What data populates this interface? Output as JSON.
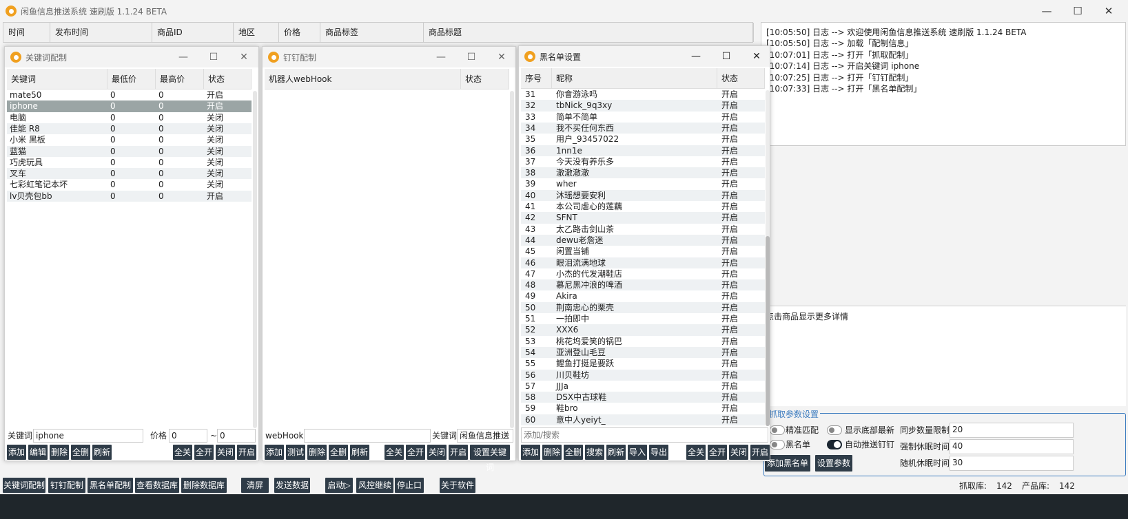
{
  "app": {
    "title": "闲鱼信息推送系统 速刷版 1.1.24 BETA"
  },
  "main_table": {
    "columns": [
      "时间",
      "发布时间",
      "商品ID",
      "地区",
      "价格",
      "商品标签",
      "商品标题"
    ]
  },
  "log": {
    "lines": [
      "[10:05:50] 日志 --> 欢迎使用闲鱼信息推送系统 速刷版 1.1.24 BETA",
      "[10:05:50] 日志 --> 加载「配制信息」",
      "[10:07:01] 日志 --> 打开「抓取配制」",
      "[10:07:14] 日志 --> 开启关键词 iphone",
      "[10:07:25] 日志 --> 打开「钉钉配制」",
      "[10:07:33] 日志 --> 打开「黑名单配制」"
    ]
  },
  "detail": {
    "hint": "点击商品显示更多详情"
  },
  "settings": {
    "group_title": "抓取参数设置",
    "exact_match": "精准匹配",
    "blacklist": "黑名单",
    "show_bottom_latest": "显示底部最新",
    "auto_push": "自动推送钉钉",
    "sync_limit_label": "同步数量限制",
    "sync_limit_value": "20",
    "force_sleep_label": "强制休眠时间",
    "force_sleep_value": "40",
    "random_sleep_label": "随机休眠时间",
    "random_sleep_value": "30",
    "add_blacklist_btn": "添加黑名单",
    "set_params_btn": "设置参数"
  },
  "keyword_panel": {
    "title": "关键词配制",
    "columns": [
      "关键词",
      "最低价",
      "最高价",
      "状态"
    ],
    "rows": [
      [
        "mate50",
        "0",
        "0",
        "开启"
      ],
      [
        "iphone",
        "0",
        "0",
        "开启"
      ],
      [
        "电脑",
        "0",
        "0",
        "关闭"
      ],
      [
        "佳能 R8",
        "0",
        "0",
        "关闭"
      ],
      [
        "小米 黑板",
        "0",
        "0",
        "关闭"
      ],
      [
        "蓝猫",
        "0",
        "0",
        "关闭"
      ],
      [
        "巧虎玩具",
        "0",
        "0",
        "关闭"
      ],
      [
        "叉车",
        "0",
        "0",
        "关闭"
      ],
      [
        "七彩虹笔记本坏",
        "0",
        "0",
        "关闭"
      ],
      [
        "lv贝壳包bb",
        "0",
        "0",
        "开启"
      ]
    ],
    "keyword_label": "关键词",
    "keyword_value": "iphone",
    "price_label": "价格",
    "price_min": "0",
    "tilde": "~",
    "price_max": "0",
    "buttons_left": [
      "添加",
      "编辑",
      "删除",
      "全删",
      "刷新"
    ],
    "buttons_right": [
      "全关",
      "全开",
      "关闭",
      "开启"
    ]
  },
  "dingtalk_panel": {
    "title": "钉钉配制",
    "columns": [
      "机器人webHook",
      "状态"
    ],
    "webhook_label": "webHook",
    "keyword_label": "关键词",
    "keyword_value": "闲鱼信息推送",
    "buttons_left": [
      "添加",
      "测试",
      "删除",
      "全删",
      "刷新"
    ],
    "buttons_right": [
      "全关",
      "全开",
      "关闭",
      "开启",
      "设置关键词"
    ]
  },
  "blacklist_panel": {
    "title": "黑名单设置",
    "columns": [
      "序号",
      "昵称",
      "状态"
    ],
    "rows": [
      [
        "31",
        "你會游泳吗",
        "开启"
      ],
      [
        "32",
        "tbNick_9q3xy",
        "开启"
      ],
      [
        "33",
        "简单不简单",
        "开启"
      ],
      [
        "34",
        "我不买任何东西",
        "开启"
      ],
      [
        "35",
        "用户_93457022",
        "开启"
      ],
      [
        "36",
        "1nn1e",
        "开启"
      ],
      [
        "37",
        "今天没有养乐多",
        "开启"
      ],
      [
        "38",
        "澈澈澈澈",
        "开启"
      ],
      [
        "39",
        "wher",
        "开启"
      ],
      [
        "40",
        "沐瑶想要安利",
        "开启"
      ],
      [
        "41",
        "本公司虐心的莲藕",
        "开启"
      ],
      [
        "42",
        "SFNT",
        "开启"
      ],
      [
        "43",
        "太乙路击剑山茶",
        "开启"
      ],
      [
        "44",
        "dewu老詹迷",
        "开启"
      ],
      [
        "45",
        "闲置当铺",
        "开启"
      ],
      [
        "46",
        "眼泪流满地球",
        "开启"
      ],
      [
        "47",
        "小杰的代发潮鞋店",
        "开启"
      ],
      [
        "48",
        "慕尼黑冲浪的啤酒",
        "开启"
      ],
      [
        "49",
        "Akira",
        "开启"
      ],
      [
        "50",
        "荆南忠心的栗壳",
        "开启"
      ],
      [
        "51",
        "一拍即中",
        "开启"
      ],
      [
        "52",
        "XXX6",
        "开启"
      ],
      [
        "53",
        "桃花坞爱笑的锅巴",
        "开启"
      ],
      [
        "54",
        "亚洲登山毛豆",
        "开启"
      ],
      [
        "55",
        "鲤鱼打挺是要跃",
        "开启"
      ],
      [
        "56",
        "川贝鞋坊",
        "开启"
      ],
      [
        "57",
        "JJJa",
        "开启"
      ],
      [
        "58",
        "DSX中古球鞋",
        "开启"
      ],
      [
        "59",
        "鞋bro",
        "开启"
      ],
      [
        "60",
        "意中人yeiyt_",
        "开启"
      ]
    ],
    "search_placeholder": "添加/搜索",
    "buttons_left": [
      "添加",
      "删除",
      "全删",
      "搜索",
      "刷新",
      "导入",
      "导出"
    ],
    "buttons_right": [
      "全关",
      "全开",
      "关闭",
      "开启"
    ]
  },
  "bottom_bar": {
    "buttons": [
      "关键词配制",
      "钉钉配制",
      "黑名单配制",
      "查看数据库",
      "删除数据库",
      "清屏",
      "发送数据",
      "启动▷",
      "风控继续",
      "停止口",
      "关于软件"
    ],
    "crawl_label": "抓取库:",
    "crawl_value": "142",
    "product_label": "产品库:",
    "product_value": "142"
  }
}
